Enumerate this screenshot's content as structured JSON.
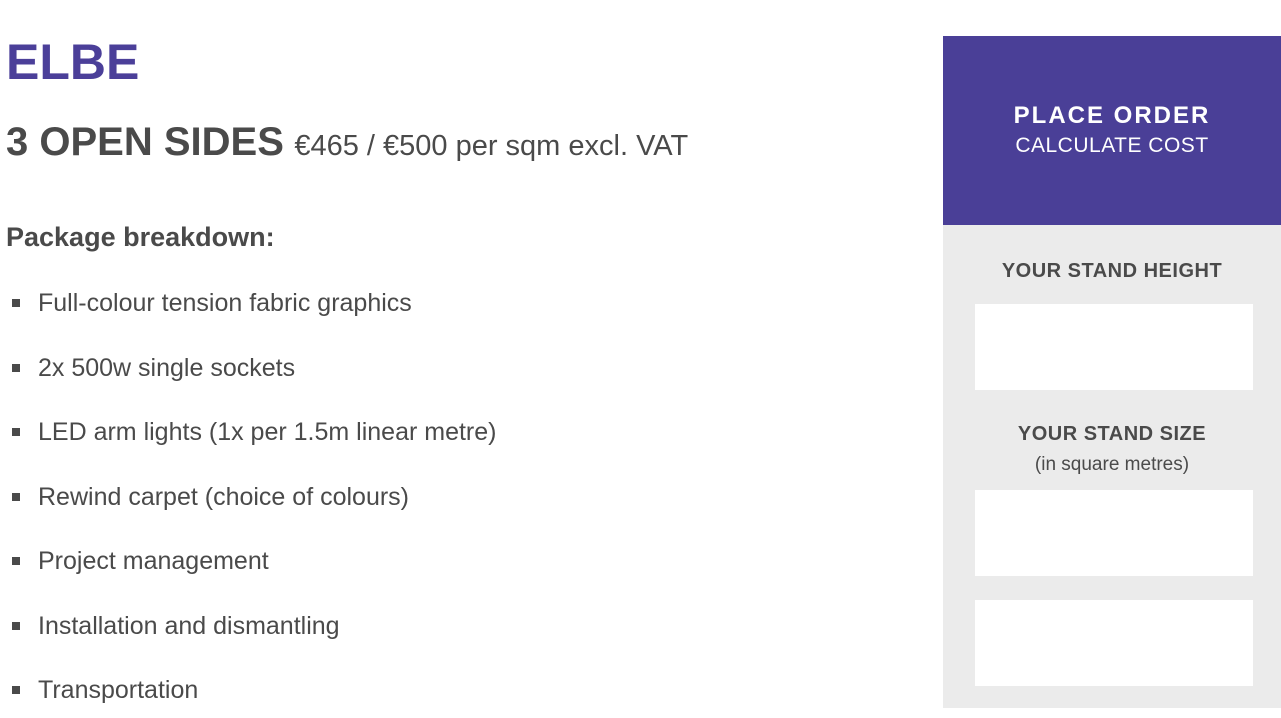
{
  "product": {
    "name": "ELBE",
    "configuration": "3 OPEN SIDES",
    "price": "€465 / €500 per sqm excl. VAT"
  },
  "breakdown": {
    "heading": "Package breakdown:",
    "items": [
      "Full-colour tension fabric graphics",
      "2x 500w single sockets",
      "LED arm lights (1x per 1.5m linear metre)",
      "Rewind carpet (choice of colours)",
      "Project management",
      "Installation and dismantling",
      "Transportation"
    ]
  },
  "sidebar": {
    "order_title": "PLACE ORDER",
    "order_subtitle": "CALCULATE COST",
    "height_label": "YOUR STAND HEIGHT",
    "height_value": "",
    "size_label": "YOUR STAND SIZE",
    "size_note": "(in square metres)",
    "size_value": "",
    "extra_value": ""
  },
  "colors": {
    "brand_purple": "#4a3f97",
    "panel_grey": "#ebebeb",
    "text_dark": "#4a4a4a"
  }
}
